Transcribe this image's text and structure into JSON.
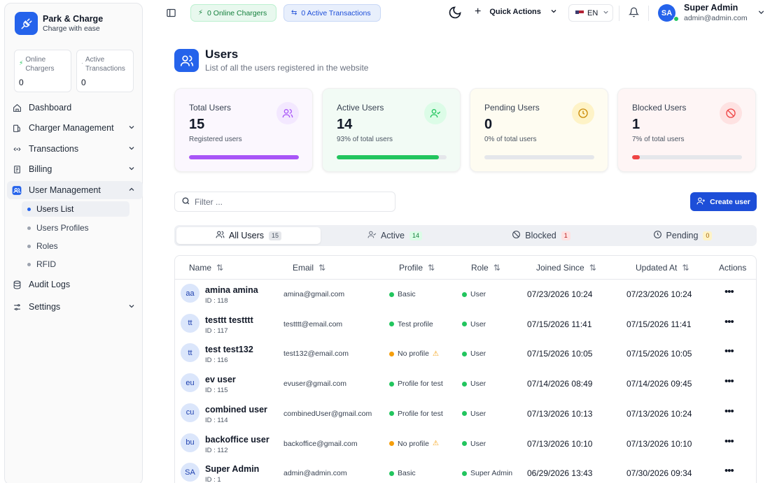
{
  "brand": {
    "name": "Park & Charge",
    "tagline": "Charge with ease"
  },
  "sidebar": {
    "mini_cards": [
      {
        "label": "Online Chargers",
        "value": "0"
      },
      {
        "label": "Active Transactions",
        "value": "0"
      }
    ],
    "items": [
      {
        "label": "Dashboard",
        "icon": "home-icon"
      },
      {
        "label": "Charger Management",
        "icon": "charger-icon"
      },
      {
        "label": "Transactions",
        "icon": "transactions-icon"
      },
      {
        "label": "Billing",
        "icon": "billing-icon"
      },
      {
        "label": "User Management",
        "icon": "users-icon"
      },
      {
        "label": "Audit Logs",
        "icon": "database-icon"
      },
      {
        "label": "Settings",
        "icon": "settings-icon"
      }
    ],
    "sub_items": [
      {
        "label": "Users List"
      },
      {
        "label": "Users Profiles"
      },
      {
        "label": "Roles"
      },
      {
        "label": "RFID"
      }
    ]
  },
  "header": {
    "online_chargers": "0 Online Chargers",
    "active_transactions": "0 Active Transactions",
    "quick_actions": "Quick Actions",
    "language": "EN",
    "user_initials": "SA",
    "user_name": "Super Admin",
    "user_email": "admin@admin.com"
  },
  "page": {
    "title": "Users",
    "subtitle": "List of all the users registered in the website"
  },
  "stats": [
    {
      "title": "Total Users",
      "value": "15",
      "subtitle": "Registered users",
      "progress": 1.0,
      "color": "#a855f7",
      "bg": "#fbf7fe",
      "icon_bg": "#f3e8ff",
      "icon": "users-icon"
    },
    {
      "title": "Active Users",
      "value": "14",
      "subtitle": "93% of total users",
      "progress": 0.93,
      "color": "#22c55e",
      "bg": "#f2fbf5",
      "icon_bg": "#dcfce7",
      "icon": "user-check-icon"
    },
    {
      "title": "Pending Users",
      "value": "0",
      "subtitle": "0% of total users",
      "progress": 0.0,
      "color": "#eab308",
      "bg": "#fefcf1",
      "icon_bg": "#fef3c7",
      "icon": "clock-icon"
    },
    {
      "title": "Blocked Users",
      "value": "1",
      "subtitle": "7% of total users",
      "progress": 0.07,
      "color": "#ef4444",
      "bg": "#fef5f5",
      "icon_bg": "#fee2e2",
      "icon": "ban-icon"
    }
  ],
  "filter": {
    "placeholder": "Filter ..."
  },
  "create_button": "Create user",
  "tabs": [
    {
      "label": "All Users",
      "count": "15"
    },
    {
      "label": "Active",
      "count": "14"
    },
    {
      "label": "Blocked",
      "count": "1"
    },
    {
      "label": "Pending",
      "count": "0"
    }
  ],
  "table": {
    "columns": [
      "Name",
      "Email",
      "Profile",
      "Role",
      "Joined Since",
      "Updated At",
      "Actions"
    ],
    "rows": [
      {
        "initials": "aa",
        "name": "amina amina",
        "id": "ID : 118",
        "email": "amina@gmail.com",
        "profile": "Basic",
        "profile_status": "green",
        "role": "User",
        "joined": "07/23/2026 10:24",
        "updated": "07/23/2026 10:24"
      },
      {
        "initials": "tt",
        "name": "testtt testttt",
        "id": "ID : 117",
        "email": "testttt@email.com",
        "profile": "Test profile",
        "profile_status": "green",
        "role": "User",
        "joined": "07/15/2026 11:41",
        "updated": "07/15/2026 11:41"
      },
      {
        "initials": "tt",
        "name": "test test132",
        "id": "ID : 116",
        "email": "test132@email.com",
        "profile": "No profile",
        "profile_status": "orange",
        "role": "User",
        "joined": "07/15/2026 10:05",
        "updated": "07/15/2026 10:05"
      },
      {
        "initials": "eu",
        "name": "ev user",
        "id": "ID : 115",
        "email": "evuser@gmail.com",
        "profile": "Profile for test",
        "profile_status": "green",
        "role": "User",
        "joined": "07/14/2026 08:49",
        "updated": "07/14/2026 09:45"
      },
      {
        "initials": "cu",
        "name": "combined user",
        "id": "ID : 114",
        "email": "combinedUser@gmail.com",
        "profile": "Profile for test",
        "profile_status": "green",
        "role": "User",
        "joined": "07/13/2026 10:13",
        "updated": "07/13/2026 10:24"
      },
      {
        "initials": "bu",
        "name": "backoffice user",
        "id": "ID : 112",
        "email": "backoffice@gmail.com",
        "profile": "No profile",
        "profile_status": "orange",
        "role": "User",
        "joined": "07/13/2026 10:10",
        "updated": "07/13/2026 10:10"
      },
      {
        "initials": "SA",
        "name": "Super Admin",
        "id": "ID : 1",
        "email": "admin@admin.com",
        "profile": "Basic",
        "profile_status": "green",
        "role": "Super Admin",
        "joined": "06/29/2026 13:43",
        "updated": "07/30/2026 09:34"
      }
    ]
  },
  "colors": {
    "accent": "#2563eb",
    "green": "#22c55e",
    "orange": "#f59e0b"
  }
}
